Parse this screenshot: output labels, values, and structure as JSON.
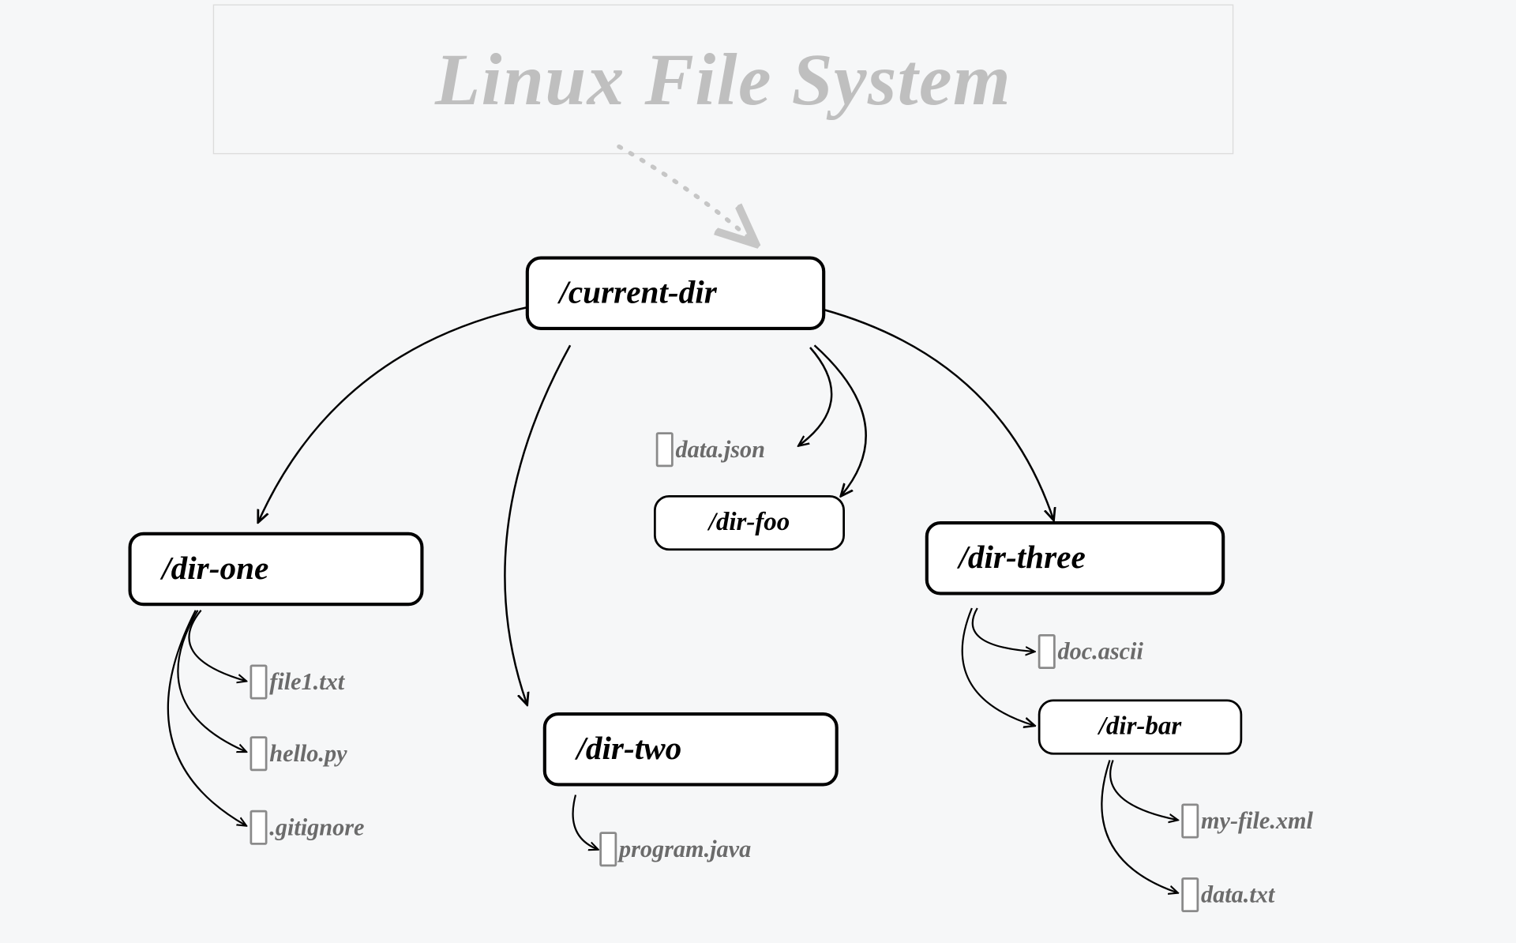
{
  "title": "Linux File System",
  "root": {
    "label": "/current-dir"
  },
  "dirOne": {
    "label": "/dir-one"
  },
  "dirTwo": {
    "label": "/dir-two"
  },
  "dirThree": {
    "label": "/dir-three"
  },
  "dirFoo": {
    "label": "/dir-foo"
  },
  "dirBar": {
    "label": "/dir-bar"
  },
  "files": {
    "dataJson": "data.json",
    "file1": "file1.txt",
    "hello": "hello.py",
    "gitignore": ".gitignore",
    "program": "program.java",
    "docAscii": "doc.ascii",
    "myFile": "my-file.xml",
    "dataTxt": "data.txt"
  }
}
